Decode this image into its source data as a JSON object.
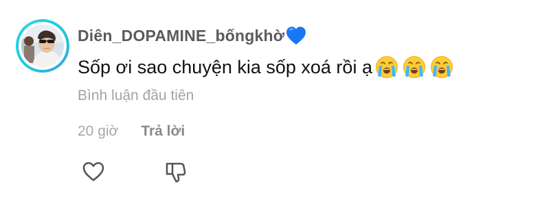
{
  "comment": {
    "username": "Diên_DOPAMINE_bốngkhờ",
    "username_emoji": "blue-heart",
    "text": "Sốp ơi sao chuyện kia sốp xoá rồi ạ",
    "text_emojis": [
      "loudly-crying-face",
      "loudly-crying-face",
      "loudly-crying-face"
    ],
    "subtitle": "Bình luận đầu tiên",
    "time": "20 giờ",
    "reply_label": "Trả lời"
  },
  "actions": {
    "like_icon": "heart-outline-icon",
    "dislike_icon": "thumbs-down-icon"
  },
  "colors": {
    "avatar_ring": "#1ec6dc",
    "username": "#5a5a5a",
    "text": "#111111",
    "muted": "#a3a3a3",
    "heart": "#1877f2"
  }
}
